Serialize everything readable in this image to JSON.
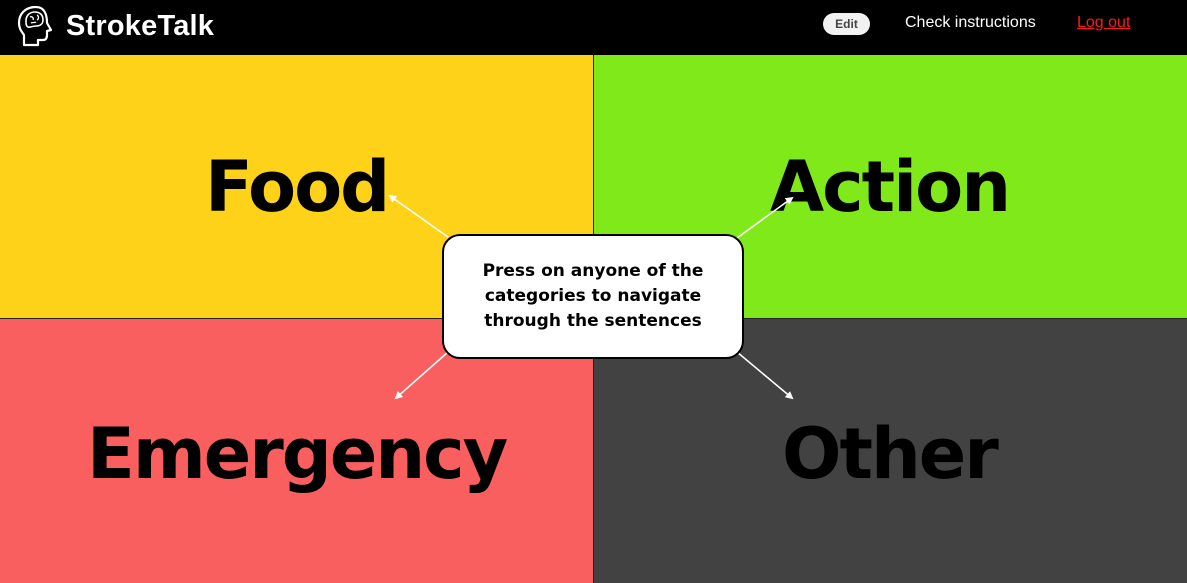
{
  "header": {
    "brand": "StrokeTalk",
    "logo_icon": "head-brain-icon",
    "edit_label": "Edit",
    "instructions_label": "Check instructions",
    "logout_label": "Log out"
  },
  "categories": [
    {
      "label": "Food",
      "color": "#fed219"
    },
    {
      "label": "Action",
      "color": "#7fe919"
    },
    {
      "label": "Emergency",
      "color": "#f85f5e"
    },
    {
      "label": "Other",
      "color": "#424242"
    }
  ],
  "instruction_box": {
    "text": "Press on anyone of the categories to navigate through the sentences"
  },
  "colors": {
    "header_bg": "#000000",
    "logout": "#ff1a1a"
  }
}
